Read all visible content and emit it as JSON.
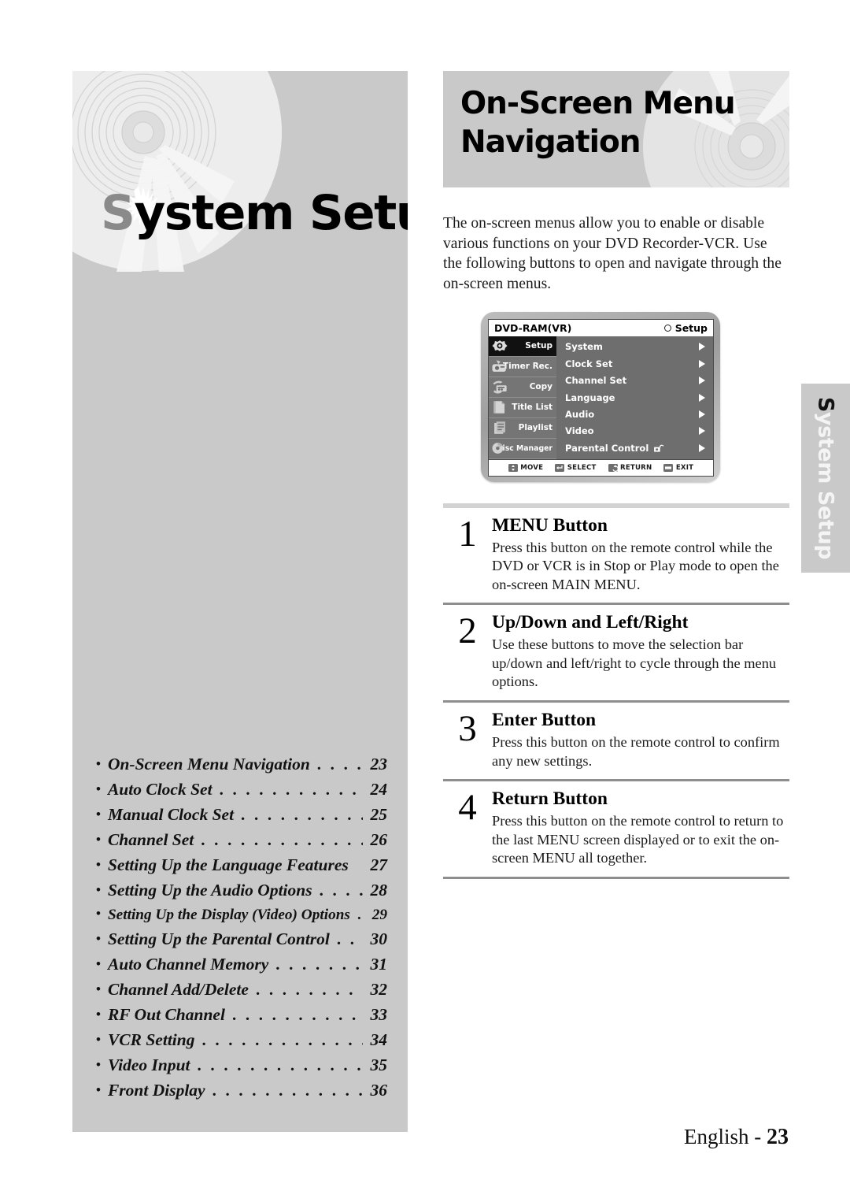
{
  "chapter": {
    "title_initial": "S",
    "title_rest": "ystem Setup",
    "graphic": "dvd-disc-illustration"
  },
  "side_tab": {
    "initial": "S",
    "rest": "ystem Setup"
  },
  "toc": {
    "items": [
      {
        "label": "On-Screen Menu Navigation",
        "dots": ". . . . .",
        "page": "23",
        "tight": false
      },
      {
        "label": "Auto Clock Set",
        "dots": ". . . . . . . . . . . . . .",
        "page": "24",
        "tight": false
      },
      {
        "label": "Manual Clock Set",
        "dots": ". . . . . . . . . . . .",
        "page": "25",
        "tight": false
      },
      {
        "label": "Channel Set",
        "dots": ". . . . . . . . . . . . . . . .",
        "page": "26",
        "tight": false
      },
      {
        "label": "Setting Up the Language Features",
        "dots": "",
        "page": "27",
        "tight": false
      },
      {
        "label": "Setting Up the Audio Options",
        "dots": ". . . .",
        "page": "28",
        "tight": false
      },
      {
        "label": "Setting Up the Display (Video) Options",
        "dots": ". . .",
        "page": "29",
        "tight": true
      },
      {
        "label": "Setting Up the Parental Control",
        "dots": ". . .",
        "page": "30",
        "tight": false
      },
      {
        "label": "Auto Channel Memory",
        "dots": ". . . . . . . . .",
        "page": "31",
        "tight": false
      },
      {
        "label": "Channel Add/Delete",
        "dots": ". . . . . . . . . . .",
        "page": "32",
        "tight": false
      },
      {
        "label": "RF Out Channel",
        "dots": ". . . . . . . . . . . . . .",
        "page": "33",
        "tight": false
      },
      {
        "label": "VCR Setting",
        "dots": ". . . . . . . . . . . . . . . .",
        "page": "34",
        "tight": false
      },
      {
        "label": "Video Input",
        "dots": ". . . . . . . . . . . . . . . .",
        "page": "35",
        "tight": false
      },
      {
        "label": "Front Display",
        "dots": ". . . . . . . . . . . . . . .",
        "page": "36",
        "tight": false
      }
    ]
  },
  "section": {
    "title_line1": "On-Screen Menu",
    "title_line2": "Navigation",
    "intro": "The on-screen menus allow you to enable or disable  various functions on your DVD Recorder-VCR. Use the following buttons to open and navigate through the on-screen menus."
  },
  "osd": {
    "disc_label": "DVD-RAM(VR)",
    "mode_label": "Setup",
    "sidebar": [
      {
        "label": "Setup",
        "icon": "gear-icon",
        "active": true,
        "small": false
      },
      {
        "label": "Timer Rec.",
        "icon": "timer-record-icon",
        "active": false,
        "small": false
      },
      {
        "label": "Copy",
        "icon": "copy-icon",
        "active": false,
        "small": false
      },
      {
        "label": "Title List",
        "icon": "title-list-icon",
        "active": false,
        "small": false
      },
      {
        "label": "Playlist",
        "icon": "playlist-icon",
        "active": false,
        "small": false
      },
      {
        "label": "Disc Manager",
        "icon": "disc-manager-icon",
        "active": false,
        "small": true
      }
    ],
    "menu_items": [
      {
        "label": "System",
        "lock": false
      },
      {
        "label": "Clock Set",
        "lock": false
      },
      {
        "label": "Channel Set",
        "lock": false
      },
      {
        "label": "Language",
        "lock": false
      },
      {
        "label": "Audio",
        "lock": false
      },
      {
        "label": "Video",
        "lock": false
      },
      {
        "label": "Parental Control",
        "lock": true
      }
    ],
    "footer_buttons": [
      {
        "label": "MOVE",
        "icon": "updown-arrows-icon"
      },
      {
        "label": "SELECT",
        "icon": "enter-key-icon"
      },
      {
        "label": "RETURN",
        "icon": "return-arrow-icon"
      },
      {
        "label": "EXIT",
        "icon": "exit-key-icon"
      }
    ]
  },
  "steps": [
    {
      "number": "1",
      "heading": "MENU Button",
      "text": "Press this button on the remote control while the DVD or VCR is in Stop or Play mode to open the on-screen MAIN MENU."
    },
    {
      "number": "2",
      "heading": "Up/Down and Left/Right",
      "text": "Use these buttons to move the selection bar up/down and left/right to cycle through the menu options."
    },
    {
      "number": "3",
      "heading": "Enter  Button",
      "text": "Press this button on the remote control to confirm any new settings."
    },
    {
      "number": "4",
      "heading": "Return  Button",
      "text": "Press this button on the remote control to return to the last MENU screen displayed or to exit the on-screen MENU all together."
    }
  ],
  "footer": {
    "language": "English - ",
    "page": "23"
  },
  "colors": {
    "panel_gray": "#c9c9c9",
    "osd_body": "#6e6e6e",
    "osd_active": "#111111",
    "rule_light": "#d2d2d2",
    "rule_dark": "#8e8e8e"
  }
}
